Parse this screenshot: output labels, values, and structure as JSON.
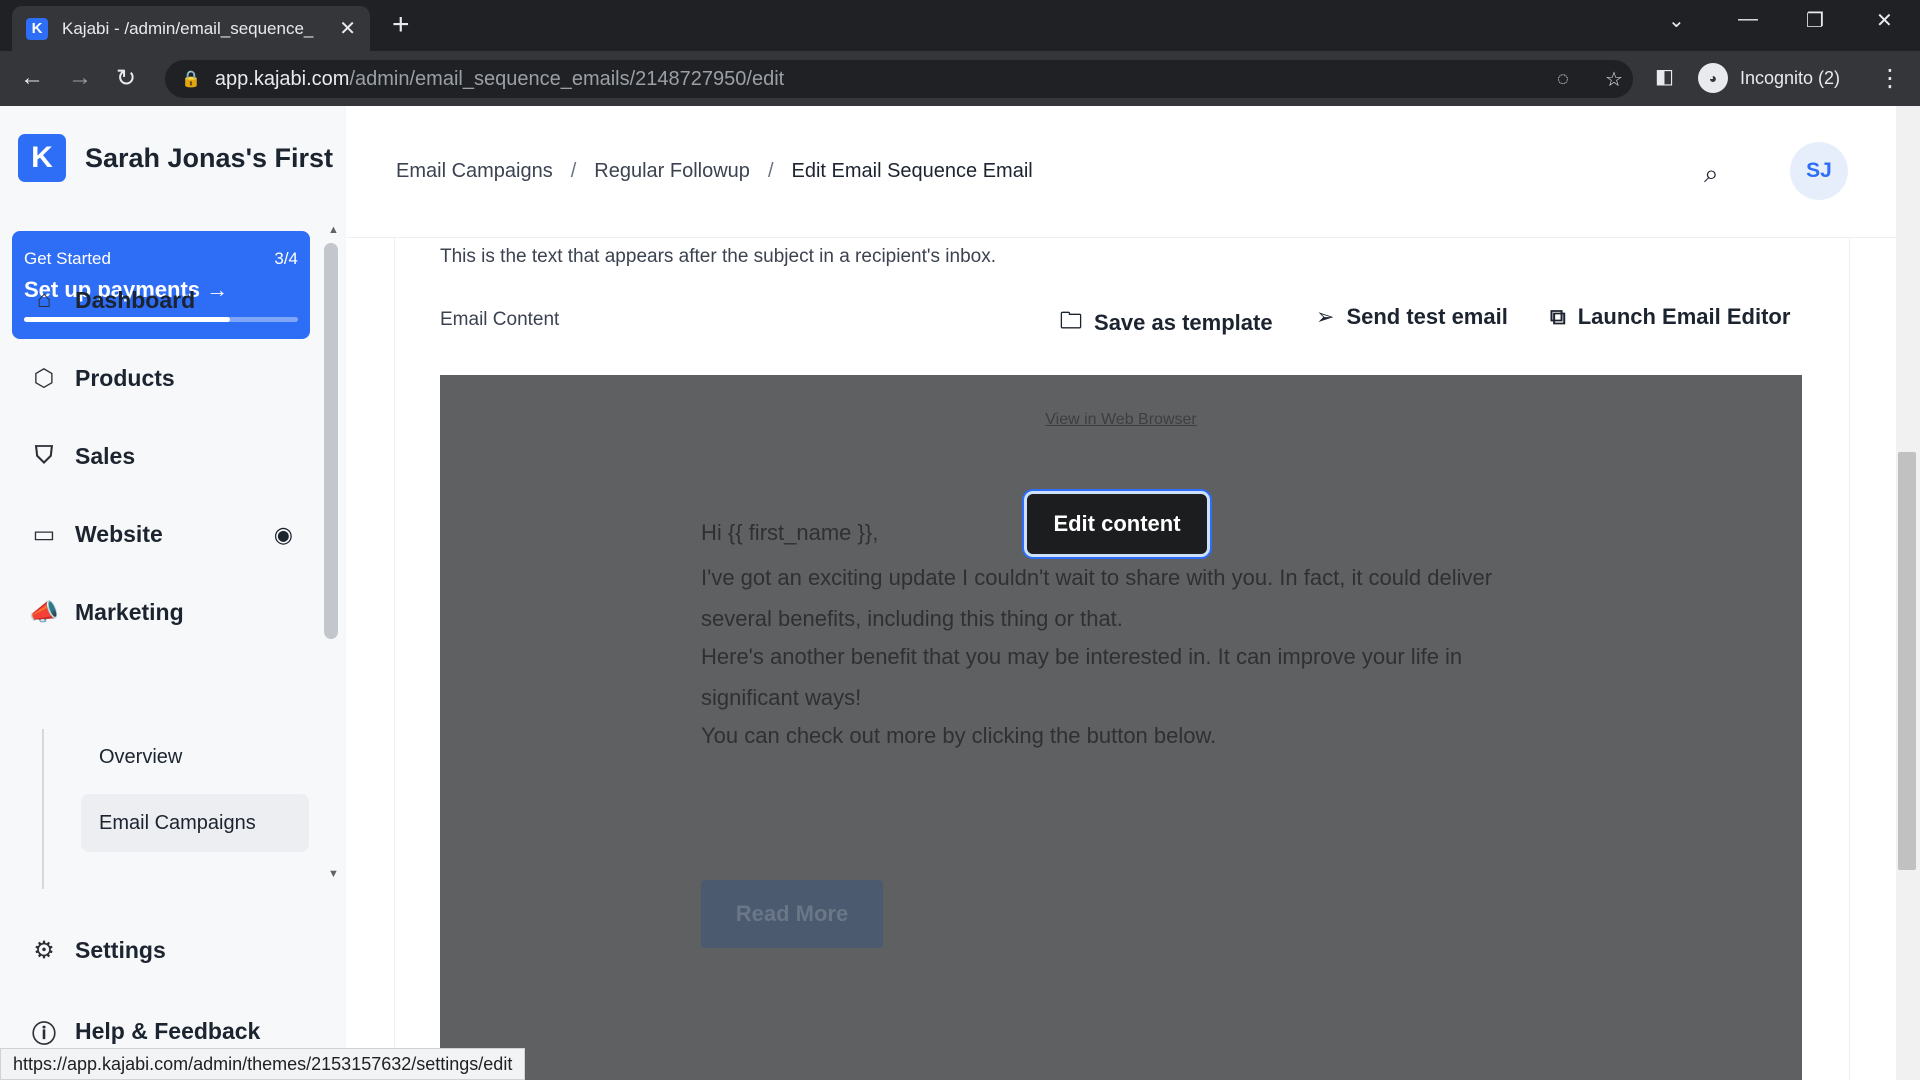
{
  "browser": {
    "tab_title": "Kajabi - /admin/email_sequence_",
    "url_host": "app.kajabi.com",
    "url_path": "/admin/email_sequence_emails/2148727950/edit",
    "incognito_label": "Incognito (2)",
    "status_url": "https://app.kajabi.com/admin/themes/2153157632/settings/edit"
  },
  "sidebar": {
    "site_name": "Sarah Jonas's First",
    "get_started": {
      "label": "Get Started",
      "progress_text": "3/4",
      "title": "Set up payments",
      "progress": 0.75
    },
    "items": [
      {
        "label": "Dashboard",
        "icon": "home-icon"
      },
      {
        "label": "Products",
        "icon": "box-icon"
      },
      {
        "label": "Sales",
        "icon": "tag-icon"
      },
      {
        "label": "Website",
        "icon": "monitor-icon"
      },
      {
        "label": "Marketing",
        "icon": "megaphone-icon"
      },
      {
        "label": "Settings",
        "icon": "gear-icon"
      },
      {
        "label": "Help & Feedback",
        "icon": "help-icon"
      }
    ],
    "subitems": [
      {
        "label": "Overview"
      },
      {
        "label": "Email Campaigns",
        "active": true
      }
    ]
  },
  "header": {
    "breadcrumbs": [
      "Email Campaigns",
      "Regular Followup",
      "Edit Email Sequence Email"
    ],
    "avatar_initials": "SJ"
  },
  "content": {
    "helptext": "This is the text that appears after the subject in a recipient's inbox.",
    "email_content_label": "Email Content",
    "actions": {
      "save_template": "Save as template",
      "send_test": "Send test email",
      "launch_editor": "Launch Email Editor"
    },
    "preview": {
      "web_browser_link": "View in Web Browser",
      "edit_button": "Edit content",
      "greeting": "Hi {{ first_name }},",
      "para1": "I've got an exciting update I couldn't wait to share with you. In fact, it could deliver several benefits, including this thing or that.",
      "para2": "Here's another benefit that you may be interested in. It can improve your life in significant ways!",
      "para3": "You can check out more by clicking the button below.",
      "cta": "Read More"
    }
  }
}
